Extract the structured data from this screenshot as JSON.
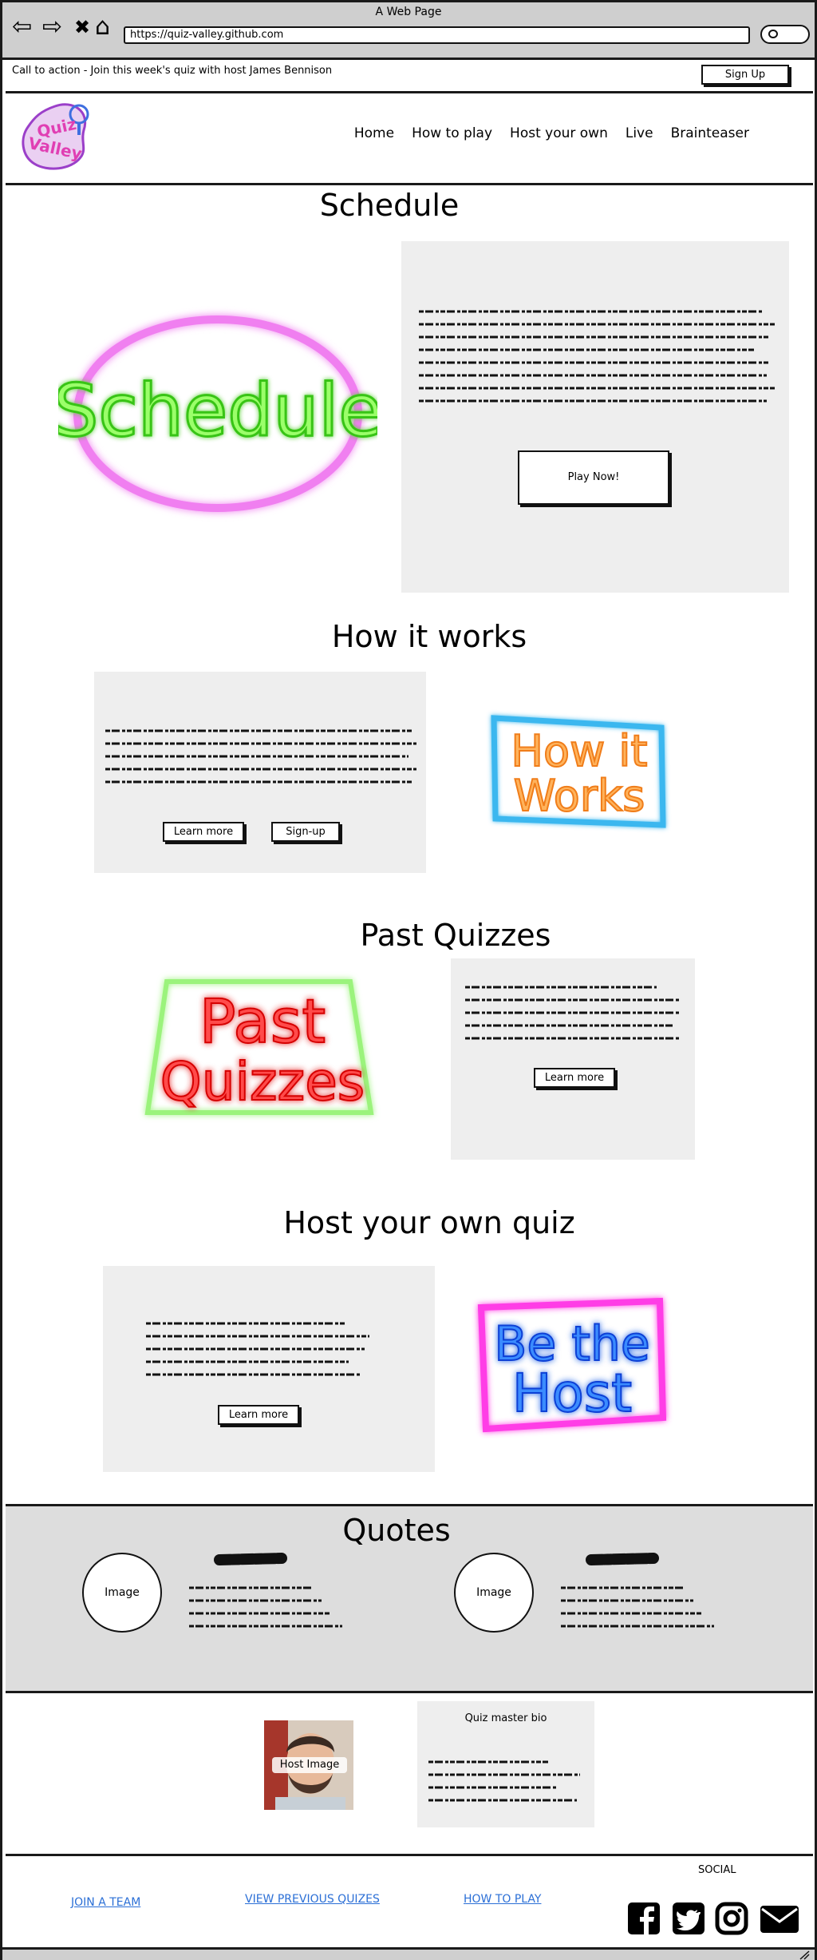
{
  "browser": {
    "window_title": "A Web Page",
    "url": "https://quiz-valley.github.com",
    "back_glyph": "⇦",
    "forward_glyph": "⇨",
    "stop_glyph": "✖",
    "home_glyph": "⌂"
  },
  "announce": {
    "text": "Call to action - Join this week's quiz with host James Bennison",
    "signup_label": "Sign Up"
  },
  "header": {
    "logo_text_1": "Quiz",
    "logo_text_2": "Valley",
    "nav": [
      "Home",
      "How to play",
      "Host your own",
      "Live",
      "Brainteaser"
    ]
  },
  "schedule": {
    "title": "Schedule",
    "neon_text": "Schedule",
    "play_label": "Play Now!"
  },
  "how_it_works": {
    "title": "How it works",
    "neon_line1": "How it",
    "neon_line2": "Works",
    "learn_label": "Learn more",
    "signup_label": "Sign-up"
  },
  "past": {
    "title": "Past Quizzes",
    "neon_line1": "Past",
    "neon_line2": "Quizzes",
    "learn_label": "Learn more"
  },
  "host": {
    "title": "Host your own quiz",
    "neon_line1": "Be the",
    "neon_line2": "Host",
    "learn_label": "Learn more"
  },
  "quotes": {
    "title": "Quotes",
    "image_label_1": "Image",
    "image_label_2": "Image"
  },
  "bio": {
    "host_image_label": "Host Image",
    "title": "Quiz master bio"
  },
  "footer": {
    "social_label": "SOCIAL",
    "link1": "JOIN A TEAM",
    "link2": "VIEW PREVIOUS QUIZES",
    "link3": "HOW TO PLAY",
    "icons": [
      "facebook-icon",
      "twitter-icon",
      "instagram-icon",
      "email-icon"
    ]
  },
  "colors": {
    "link": "#2b6fd6",
    "panel": "#eeeeee",
    "quotes_band": "#dddddd",
    "chrome": "#cfcfcf"
  }
}
